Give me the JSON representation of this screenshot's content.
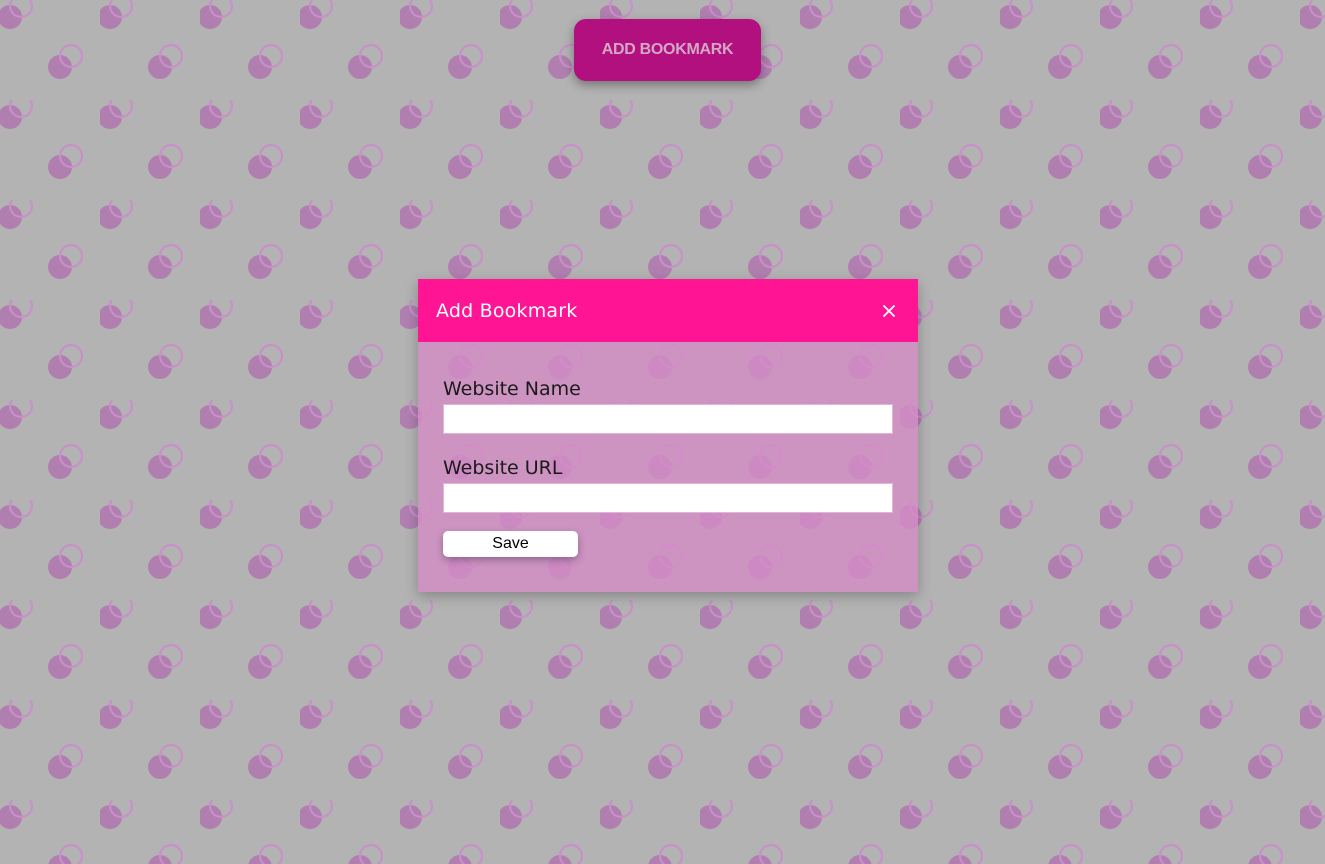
{
  "page": {
    "add_bookmark_button": "ADD BOOKMARK"
  },
  "modal": {
    "title": "Add Bookmark",
    "close_icon": "close-icon",
    "fields": [
      {
        "label": "Website Name",
        "value": "",
        "placeholder": ""
      },
      {
        "label": "Website URL",
        "value": "",
        "placeholder": ""
      }
    ],
    "save_label": "Save"
  },
  "colors": {
    "background": "#b3b3b3",
    "header": "#ff1493",
    "button": "#b20f7f",
    "modal_body": "#d58cc7"
  }
}
